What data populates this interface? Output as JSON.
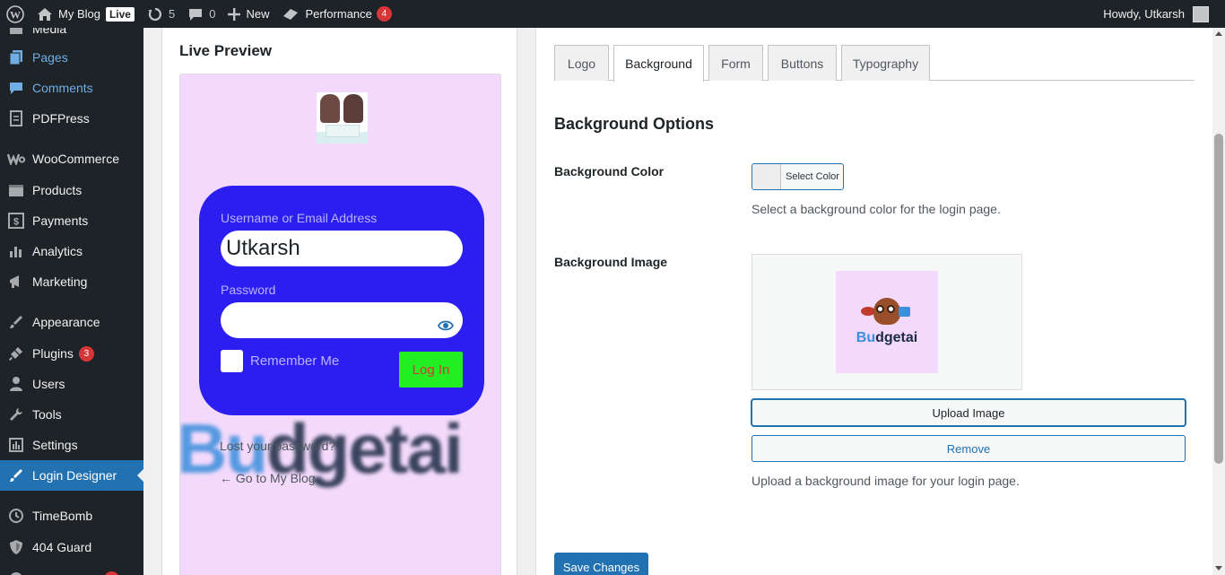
{
  "adminbar": {
    "site_name": "My Blog",
    "live_badge": "Live",
    "updates_count": "5",
    "comments_count": "0",
    "new_label": "New",
    "performance_label": "Performance",
    "performance_badge": "4",
    "howdy": "Howdy, Utkarsh"
  },
  "sidebar": {
    "items": [
      {
        "label": "Media",
        "icon": "media-icon"
      },
      {
        "label": "Pages",
        "icon": "pages-icon"
      },
      {
        "label": "Comments",
        "icon": "comments-icon"
      },
      {
        "label": "PDFPress",
        "icon": "pdf-icon"
      },
      {
        "label": "WooCommerce",
        "icon": "woocommerce-icon"
      },
      {
        "label": "Products",
        "icon": "products-icon"
      },
      {
        "label": "Payments",
        "icon": "payments-icon"
      },
      {
        "label": "Analytics",
        "icon": "analytics-icon"
      },
      {
        "label": "Marketing",
        "icon": "marketing-icon"
      },
      {
        "label": "Appearance",
        "icon": "appearance-icon"
      },
      {
        "label": "Plugins",
        "icon": "plugins-icon",
        "badge": "3"
      },
      {
        "label": "Users",
        "icon": "users-icon"
      },
      {
        "label": "Tools",
        "icon": "tools-icon"
      },
      {
        "label": "Settings",
        "icon": "settings-icon"
      },
      {
        "label": "Login Designer",
        "icon": "login-designer-icon"
      },
      {
        "label": "TimeBomb",
        "icon": "timebomb-icon"
      },
      {
        "label": "404 Guard",
        "icon": "shield-icon"
      }
    ]
  },
  "preview": {
    "title": "Live Preview",
    "username_label": "Username or Email Address",
    "username_value": "Utkarsh",
    "password_label": "Password",
    "remember_label": "Remember Me",
    "login_button": "Log In",
    "lost_password": "Lost your password?",
    "back_link": "← Go to My Blog",
    "background_text_bu": "Bu",
    "background_text_rest": "dgetai"
  },
  "tabs": [
    {
      "label": "Logo"
    },
    {
      "label": "Background"
    },
    {
      "label": "Form"
    },
    {
      "label": "Buttons"
    },
    {
      "label": "Typography"
    }
  ],
  "settings": {
    "section_title": "Background Options",
    "bg_color_label": "Background Color",
    "select_color_label": "Select Color",
    "bg_color_desc": "Select a background color for the login page.",
    "bg_image_label": "Background Image",
    "thumb_text_bu": "Bu",
    "thumb_text_rest": "dgetai",
    "upload_button": "Upload Image",
    "remove_button": "Remove",
    "bg_image_desc": "Upload a background image for your login page.",
    "save_button": "Save Changes"
  },
  "colors": {
    "admin_bar": "#1d2327",
    "accent": "#2271b1",
    "form_bg": "#2c1ef0",
    "preview_bg": "#f3d9fb",
    "login_button_bg": "#22ee22"
  }
}
